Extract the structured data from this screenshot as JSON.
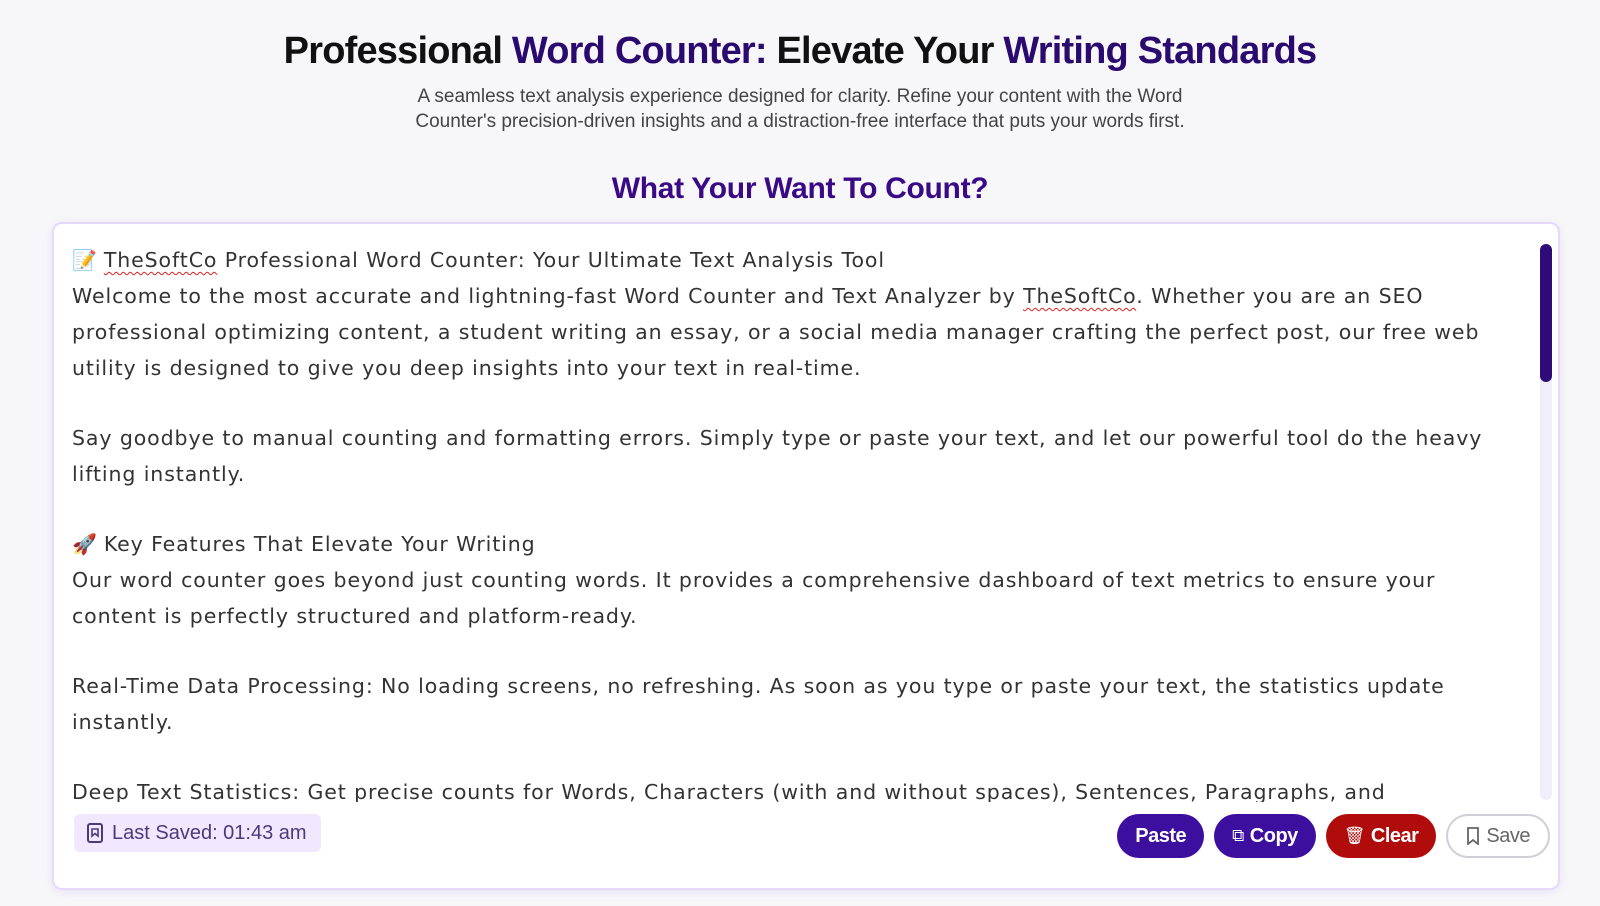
{
  "header": {
    "title_part1": "Professional ",
    "title_hl1": "Word Counter:",
    "title_part2": " Elevate Your ",
    "title_hl2": "Writing Standards",
    "subtitle_line1": "A seamless text analysis experience designed for clarity. Refine your content with the Word",
    "subtitle_line2": "Counter's precision-driven insights and a distraction-free interface that puts your words first."
  },
  "section_title": "What Your Want To Count?",
  "editor": {
    "heading1": "TheSoftCo Professional Word Counter: Your Ultimate Text Analysis Tool",
    "para1_a": "Welcome to the most accurate and lightning-fast Word Counter and Text Analyzer by ",
    "para1_brand": "TheSoftCo",
    "para1_b": ". Whether you are an SEO professional optimizing content, a student writing an essay, or a social media manager crafting the perfect post, our free web utility is designed to give you deep insights into your text in real-time.",
    "para2": "Say goodbye to manual counting and formatting errors. Simply type or paste your text, and let our powerful tool do the heavy lifting instantly.",
    "heading2": "Key Features That Elevate Your Writing",
    "para3": "Our word counter goes beyond just counting words. It provides a comprehensive dashboard of text metrics to ensure your content is perfectly structured and platform-ready.",
    "para4": "Real-Time Data Processing: No loading screens, no refreshing. As soon as you type or paste your text, the statistics update instantly.",
    "para5": "Deep Text Statistics: Get precise counts for Words, Characters (with and without spaces), Sentences, Paragraphs, and",
    "heading1_icon": "memo-icon",
    "heading2_icon": "rocket-icon"
  },
  "footer": {
    "last_saved": "Last Saved: 01:43 am",
    "paste_label": "Paste",
    "copy_label": "Copy",
    "clear_label": "Clear",
    "save_label": "Save"
  },
  "colors": {
    "accent": "#3d0f9e",
    "danger": "#b00c0c",
    "title_highlight": "#2a0a6e"
  }
}
